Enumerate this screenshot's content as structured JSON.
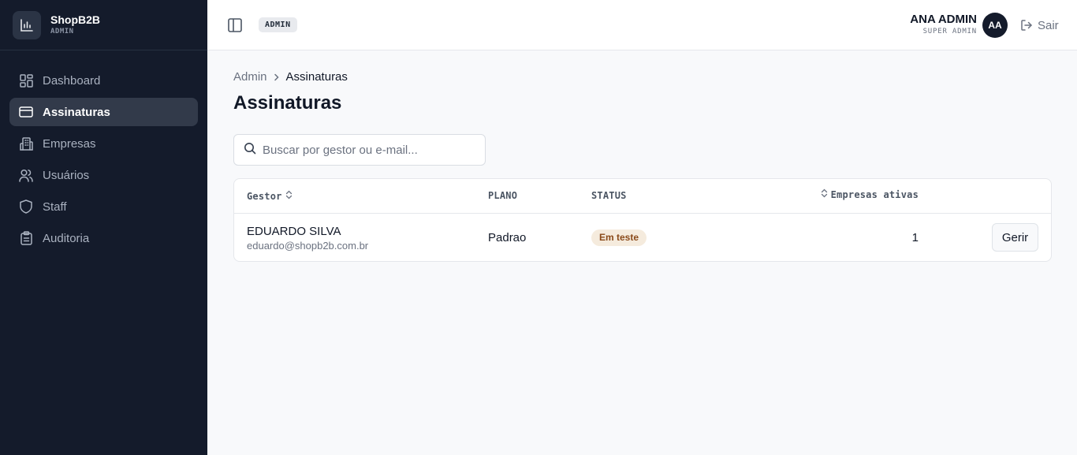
{
  "brand": {
    "name": "ShopB2B",
    "subtitle": "ADMIN",
    "icon": "bar-chart-icon"
  },
  "sidebar": {
    "items": [
      {
        "label": "Dashboard",
        "icon": "dashboard-icon",
        "active": false
      },
      {
        "label": "Assinaturas",
        "icon": "credit-card-icon",
        "active": true
      },
      {
        "label": "Empresas",
        "icon": "building-icon",
        "active": false
      },
      {
        "label": "Usuários",
        "icon": "users-icon",
        "active": false
      },
      {
        "label": "Staff",
        "icon": "shield-icon",
        "active": false
      },
      {
        "label": "Auditoria",
        "icon": "clipboard-icon",
        "active": false
      }
    ]
  },
  "header": {
    "role_badge": "ADMIN",
    "user_name": "ANA ADMIN",
    "user_role": "SUPER ADMIN",
    "avatar_initials": "AA",
    "logout_label": "Sair"
  },
  "breadcrumb": {
    "parent": "Admin",
    "current": "Assinaturas"
  },
  "page": {
    "title": "Assinaturas"
  },
  "search": {
    "placeholder": "Buscar por gestor ou e-mail...",
    "value": ""
  },
  "table": {
    "columns": {
      "gestor": "Gestor",
      "plano": "PLANO",
      "status": "STATUS",
      "empresas": "Empresas ativas"
    },
    "rows": [
      {
        "name": "EDUARDO SILVA",
        "email": "eduardo@shopb2b.com.br",
        "plan": "Padrao",
        "status": "Em teste",
        "active_companies": "1",
        "action": "Gerir"
      }
    ]
  },
  "colors": {
    "sidebar_bg": "#141b2b",
    "active_item_bg": "#323a4a",
    "status_trial_bg": "#f5ebdd",
    "status_trial_text": "#8a4a1a"
  }
}
